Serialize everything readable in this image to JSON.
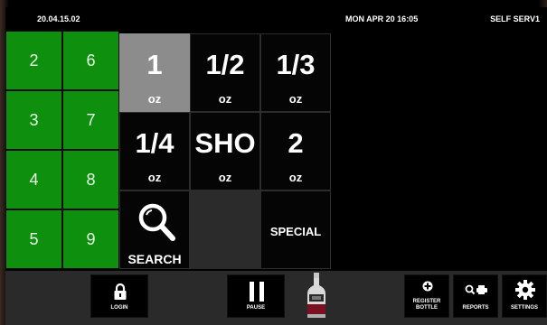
{
  "header": {
    "version": "20.04.15.02",
    "datetime": "MON APR 20 16:05",
    "station": "SELF SERV1"
  },
  "number_buttons": [
    "2",
    "6",
    "3",
    "7",
    "4",
    "8",
    "5",
    "9"
  ],
  "pour_sizes": [
    {
      "value": "1",
      "unit": "oz",
      "selected": true
    },
    {
      "value": "1/2",
      "unit": "oz"
    },
    {
      "value": "1/3",
      "unit": "oz"
    },
    {
      "value": "1/4",
      "unit": "oz"
    },
    {
      "value": "SHO",
      "unit": "oz"
    },
    {
      "value": "2",
      "unit": "oz"
    }
  ],
  "search_label": "SEARCH",
  "special_label": "SPECIAL",
  "bottom": {
    "login_label": "LOGIN",
    "pause_label": "PAUSE",
    "register_label_1": "REGISTER",
    "register_label_2": "BOTTLE",
    "reports_label": "REPORTS",
    "settings_label": "SETTINGS"
  },
  "colors": {
    "number_button": "#0e8f0e",
    "selected_pour": "#8c8c8c",
    "background": "#000000",
    "bottom_bar": "#2a2a2a"
  },
  "icons": [
    "search-icon",
    "lock-icon",
    "pause-icon",
    "bottle-icon",
    "plus-circle-icon",
    "magnifier-printer-icon",
    "gear-icon"
  ]
}
